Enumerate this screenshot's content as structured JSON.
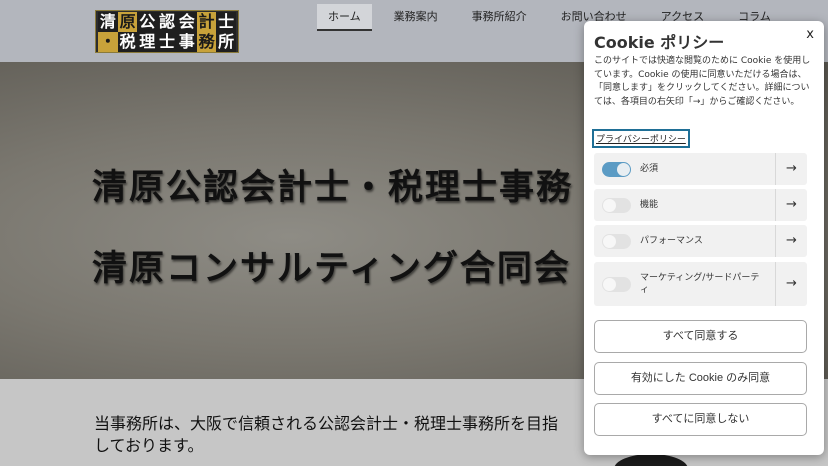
{
  "logo": {
    "row1": [
      "清",
      "原",
      "公",
      "認",
      "会",
      "計",
      "士"
    ],
    "row2": [
      "・",
      "税",
      "理",
      "士",
      "事",
      "務",
      "所"
    ]
  },
  "nav": {
    "items": [
      "ホーム",
      "業務案内",
      "事務所紹介",
      "お問い合わせ",
      "アクセス",
      "コラム"
    ]
  },
  "hero": {
    "line1": "清原公認会計士・税理士事務",
    "line2": "清原コンサルティング合同会"
  },
  "intro": {
    "text": "当事務所は、大阪で信頼される公認会計士・税理士事務所を目指しております。"
  },
  "cookie": {
    "title": "Cookie ポリシー",
    "close": "x",
    "description": "このサイトでは快適な閲覧のために Cookie を使用しています。Cookie の使用に同意いただける場合は、「同意します」をクリックしてください。詳細については、各項目の右矢印「→」からご確認ください。",
    "privacy_link": "プライバシーポリシー",
    "categories": [
      {
        "label": "必須",
        "enabled": true
      },
      {
        "label": "機能",
        "enabled": false
      },
      {
        "label": "パフォーマンス",
        "enabled": false
      },
      {
        "label": "マーケティング/サードパーティ",
        "enabled": false
      }
    ],
    "arrow": "→",
    "accept_all": "すべて同意する",
    "accept_selected": "有効にした Cookie のみ同意",
    "reject_all": "すべてに同意しない"
  },
  "colors": {
    "toggle_on": "#5b9bc4",
    "logo_gold": "#c8a23a",
    "focus_outline": "#1f6f96"
  }
}
